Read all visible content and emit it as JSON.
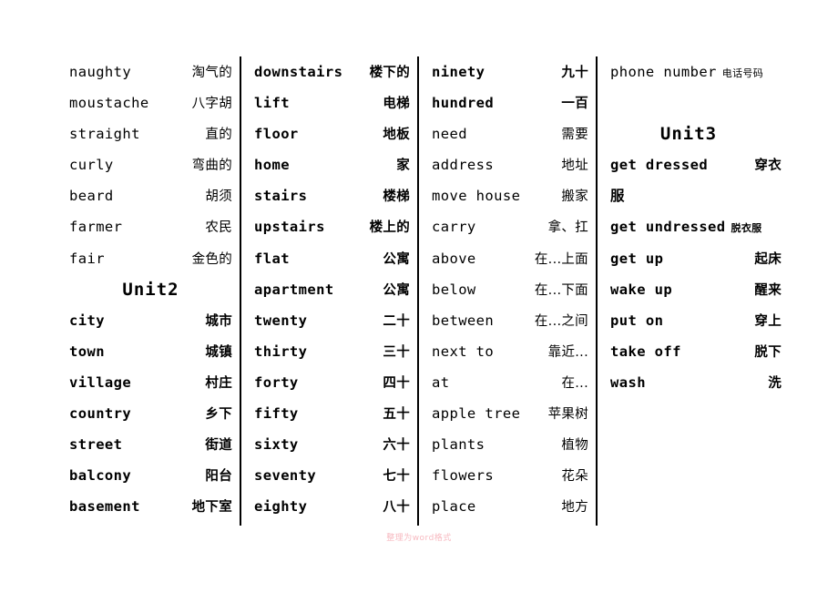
{
  "page": {
    "watermark": "整理为word格式"
  },
  "columns": [
    {
      "id": "column-1",
      "blocks": [
        {
          "type": "entry",
          "term": "naughty",
          "translation": "淘气的",
          "bold": false
        },
        {
          "type": "entry",
          "term": "moustache",
          "translation": "八字胡",
          "bold": false
        },
        {
          "type": "entry",
          "term": "straight",
          "translation": "直的",
          "bold": false
        },
        {
          "type": "entry",
          "term": "curly",
          "translation": "弯曲的",
          "bold": false
        },
        {
          "type": "entry",
          "term": "beard",
          "translation": "胡须",
          "bold": false
        },
        {
          "type": "entry",
          "term": "farmer",
          "translation": "农民",
          "bold": false
        },
        {
          "type": "entry",
          "term": "fair",
          "translation": "金色的",
          "bold": false
        },
        {
          "type": "heading",
          "text": "Unit2"
        },
        {
          "type": "entry",
          "term": "city",
          "translation": "城市",
          "bold": true
        },
        {
          "type": "entry",
          "term": "town",
          "translation": "城镇",
          "bold": true
        },
        {
          "type": "entry",
          "term": "village",
          "translation": "村庄",
          "bold": true
        },
        {
          "type": "entry",
          "term": "country",
          "translation": "乡下",
          "bold": true
        },
        {
          "type": "entry",
          "term": "street",
          "translation": "街道",
          "bold": true
        },
        {
          "type": "entry",
          "term": "balcony",
          "translation": "阳台",
          "bold": true
        },
        {
          "type": "entry",
          "term": "basement",
          "translation": "地下室",
          "bold": true
        }
      ]
    },
    {
      "id": "column-2",
      "blocks": [
        {
          "type": "entry",
          "term": "downstairs",
          "translation": "楼下的",
          "bold": true
        },
        {
          "type": "entry",
          "term": "lift",
          "translation": "电梯",
          "bold": true
        },
        {
          "type": "entry",
          "term": "floor",
          "translation": "地板",
          "bold": true
        },
        {
          "type": "entry",
          "term": "home",
          "translation": "家",
          "bold": true
        },
        {
          "type": "entry",
          "term": "stairs",
          "translation": "楼梯",
          "bold": true
        },
        {
          "type": "entry",
          "term": "upstairs",
          "translation": "楼上的",
          "bold": true
        },
        {
          "type": "entry",
          "term": "flat",
          "translation": "公寓",
          "bold": true
        },
        {
          "type": "entry",
          "term": "apartment",
          "translation": "公寓",
          "bold": true
        },
        {
          "type": "entry",
          "term": "twenty",
          "translation": "二十",
          "bold": true
        },
        {
          "type": "entry",
          "term": "thirty",
          "translation": "三十",
          "bold": true
        },
        {
          "type": "entry",
          "term": "forty",
          "translation": "四十",
          "bold": true
        },
        {
          "type": "entry",
          "term": "fifty",
          "translation": "五十",
          "bold": true
        },
        {
          "type": "entry",
          "term": "sixty",
          "translation": "六十",
          "bold": true
        },
        {
          "type": "entry",
          "term": "seventy",
          "translation": "七十",
          "bold": true
        },
        {
          "type": "entry",
          "term": "eighty",
          "translation": "八十",
          "bold": true
        }
      ]
    },
    {
      "id": "column-3",
      "blocks": [
        {
          "type": "entry",
          "term": "ninety",
          "translation": "九十",
          "bold": true
        },
        {
          "type": "entry",
          "term": "hundred",
          "translation": "一百",
          "bold": true
        },
        {
          "type": "entry",
          "term": "need",
          "translation": "需要",
          "bold": false
        },
        {
          "type": "entry",
          "term": "address",
          "translation": "地址",
          "bold": false
        },
        {
          "type": "entry",
          "term": "move house",
          "translation": "搬家",
          "bold": false
        },
        {
          "type": "entry",
          "term": "carry",
          "translation": "拿、扛",
          "bold": false
        },
        {
          "type": "entry",
          "term": "above",
          "translation": "在...上面",
          "bold": false
        },
        {
          "type": "entry",
          "term": "below",
          "translation": "在...下面",
          "bold": false
        },
        {
          "type": "entry",
          "term": "between",
          "translation": "在...之间",
          "bold": false
        },
        {
          "type": "entry",
          "term": "next to",
          "translation": "靠近...",
          "bold": false
        },
        {
          "type": "entry",
          "term": "at",
          "translation": "在...",
          "bold": false
        },
        {
          "type": "entry",
          "term": "apple tree",
          "translation": "苹果树",
          "bold": false
        },
        {
          "type": "entry",
          "term": "plants",
          "translation": "植物",
          "bold": false
        },
        {
          "type": "entry",
          "term": "flowers",
          "translation": "花朵",
          "bold": false
        },
        {
          "type": "entry",
          "term": "place",
          "translation": "地方",
          "bold": false
        }
      ]
    },
    {
      "id": "column-4",
      "blocks": [
        {
          "type": "entry-small",
          "term": "phone number",
          "translation": "电话号码",
          "bold": false
        },
        {
          "type": "spacer"
        },
        {
          "type": "heading",
          "text": "Unit3"
        },
        {
          "type": "entry",
          "term": "get dressed",
          "translation": "穿衣",
          "bold": true
        },
        {
          "type": "wrap",
          "text": "服"
        },
        {
          "type": "entry-small",
          "term": "get undressed",
          "translation": "脱衣服",
          "bold": true
        },
        {
          "type": "entry",
          "term": "get up",
          "translation": "起床",
          "bold": true
        },
        {
          "type": "entry",
          "term": "wake up",
          "translation": "醒来",
          "bold": true
        },
        {
          "type": "entry",
          "term": "put on",
          "translation": "穿上",
          "bold": true
        },
        {
          "type": "entry",
          "term": "take off",
          "translation": "脱下",
          "bold": true
        },
        {
          "type": "entry",
          "term": "wash",
          "translation": "洗",
          "bold": true
        }
      ]
    }
  ]
}
